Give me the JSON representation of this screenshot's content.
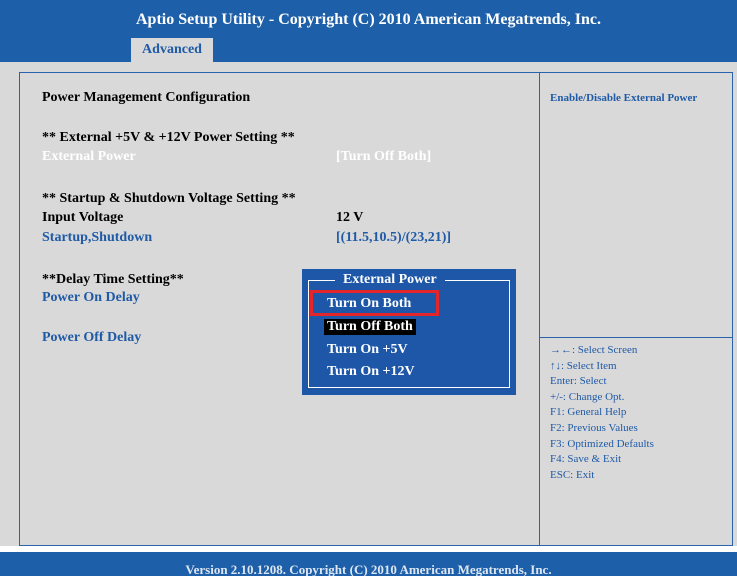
{
  "header": {
    "title": "Aptio Setup Utility - Copyright (C) 2010 American Megatrends, Inc."
  },
  "tabs": [
    {
      "label": "Advanced"
    }
  ],
  "main": {
    "section_title": "Power Management Configuration",
    "group1_heading": "** External +5V & +12V Power Setting **",
    "external_power": {
      "label": "External Power",
      "value": "[Turn Off Both]"
    },
    "group2_heading": "** Startup & Shutdown Voltage Setting **",
    "input_voltage": {
      "label": "Input Voltage",
      "value": "12 V"
    },
    "startup_shutdown": {
      "label": "Startup,Shutdown",
      "value": "[(11.5,10.5)/(23,21)]"
    },
    "group3_heading": "**Delay Time Setting**",
    "power_on_delay": {
      "label": "Power On Delay"
    },
    "power_off_delay": {
      "label": "Power Off Delay"
    }
  },
  "help": {
    "description": "Enable/Disable External Power",
    "keys": [
      "→←: Select Screen",
      "↑↓: Select Item",
      "Enter: Select",
      "+/-: Change Opt.",
      "F1: General Help",
      "F2: Previous Values",
      "F3: Optimized Defaults",
      "F4: Save & Exit",
      "ESC: Exit"
    ]
  },
  "popup": {
    "title": "External Power",
    "options": [
      "Turn On Both",
      "Turn Off Both",
      "Turn On +5V",
      "Turn On +12V"
    ],
    "selected": "Turn Off Both",
    "highlighted": "Turn On Both"
  },
  "footer": {
    "text": "Version 2.10.1208. Copyright (C) 2010 American Megatrends, Inc."
  },
  "colors": {
    "bar_blue": "#1d5fa8",
    "panel_gray": "#d9d9d9",
    "accent_blue": "#1f5aa6",
    "highlight_red": "#e3262b"
  }
}
